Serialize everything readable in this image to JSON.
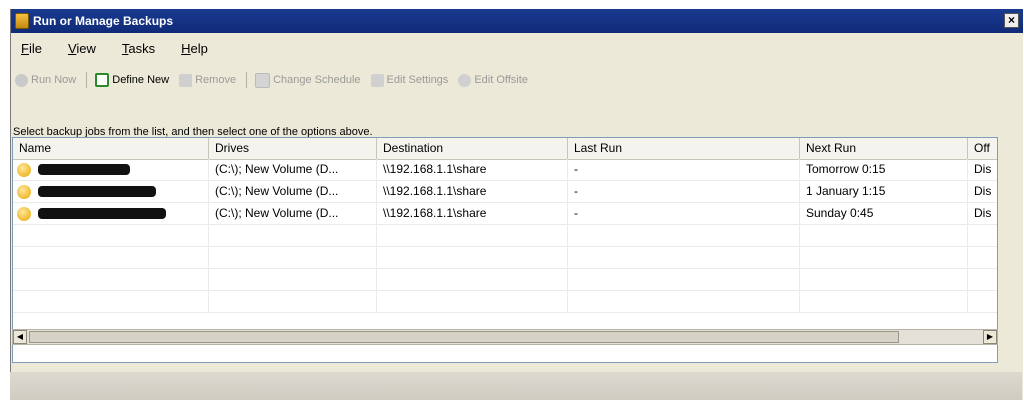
{
  "window": {
    "title": "Run or Manage Backups",
    "close_label": "×"
  },
  "menu": [
    {
      "pre": "",
      "ul": "F",
      "post": "ile"
    },
    {
      "pre": "",
      "ul": "V",
      "post": "iew"
    },
    {
      "pre": "",
      "ul": "T",
      "post": "asks"
    },
    {
      "pre": "",
      "ul": "H",
      "post": "elp"
    }
  ],
  "toolbar": {
    "run_now": "Run Now",
    "define_new": "Define New",
    "remove": "Remove",
    "change_schedule": "Change Schedule",
    "edit_settings": "Edit Settings",
    "edit_offsite": "Edit Offsite"
  },
  "instruction": "Select backup jobs from the list, and then select one of the options above.",
  "columns": [
    "Name",
    "Drives",
    "Destination",
    "Last Run",
    "Next Run",
    "Off"
  ],
  "rows": [
    {
      "drives": "(C:\\); New Volume (D...",
      "destination": "\\\\192.168.1.1\\share",
      "last_run": "-",
      "next_run": "Tomorrow 0:15",
      "offsite": "Dis"
    },
    {
      "drives": "(C:\\); New Volume (D...",
      "destination": "\\\\192.168.1.1\\share",
      "last_run": "-",
      "next_run": "1 January 1:15",
      "offsite": "Dis"
    },
    {
      "drives": "(C:\\); New Volume (D...",
      "destination": "\\\\192.168.1.1\\share",
      "last_run": "-",
      "next_run": "Sunday 0:45",
      "offsite": "Dis"
    }
  ],
  "colors": {
    "title_bg": "#1a3a8f",
    "disabled_text": "#9a9a9a",
    "window_bg": "#ece9d8"
  }
}
